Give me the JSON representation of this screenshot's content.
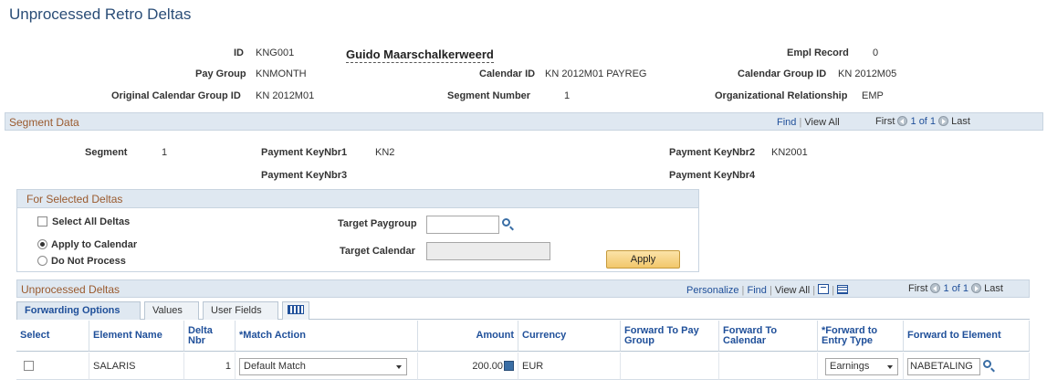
{
  "page": {
    "title": "Unprocessed Retro Deltas"
  },
  "header": {
    "id_label": "ID",
    "id_value": "KNG001",
    "name": "Guido Maarschalkerweerd",
    "empl_record_label": "Empl Record",
    "empl_record_value": "0",
    "pay_group_label": "Pay Group",
    "pay_group_value": "KNMONTH",
    "calendar_id_label": "Calendar ID",
    "calendar_id_value": "KN 2012M01 PAYREG",
    "calendar_group_id_label": "Calendar Group ID",
    "calendar_group_id_value": "KN 2012M05",
    "orig_cal_group_label": "Original Calendar Group ID",
    "orig_cal_group_value": "KN 2012M01",
    "segment_number_label": "Segment Number",
    "segment_number_value": "1",
    "org_rel_label": "Organizational Relationship",
    "org_rel_value": "EMP"
  },
  "segment_data": {
    "title": "Segment Data",
    "find": "Find",
    "view_all": "View All",
    "first": "First",
    "count": "1 of 1",
    "last": "Last",
    "segment_label": "Segment",
    "segment_value": "1",
    "pk1_label": "Payment KeyNbr1",
    "pk1_value": "KN2",
    "pk2_label": "Payment KeyNbr2",
    "pk2_value": "KN2001",
    "pk3_label": "Payment KeyNbr3",
    "pk3_value": "",
    "pk4_label": "Payment KeyNbr4",
    "pk4_value": ""
  },
  "selected_deltas": {
    "title": "For Selected Deltas",
    "select_all": "Select All Deltas",
    "apply_calendar": "Apply to Calendar",
    "do_not_process": "Do Not Process",
    "target_paygroup_label": "Target Paygroup",
    "target_paygroup_value": "",
    "target_calendar_label": "Target Calendar",
    "target_calendar_value": "",
    "apply_button": "Apply"
  },
  "unprocessed": {
    "title": "Unprocessed Deltas",
    "personalize": "Personalize",
    "find": "Find",
    "view_all": "View All",
    "first": "First",
    "count": "1 of 1",
    "last": "Last",
    "tabs": [
      "Forwarding Options",
      "Values",
      "User Fields"
    ],
    "columns": {
      "select": "Select",
      "element_name": "Element Name",
      "delta_nbr": "Delta Nbr",
      "match_action": "*Match Action",
      "amount": "Amount",
      "currency": "Currency",
      "fwd_pay_group": "Forward To Pay Group",
      "fwd_calendar": "Forward To Calendar",
      "fwd_entry_type": "*Forward to Entry Type",
      "fwd_element": "Forward to Element"
    },
    "row": {
      "element_name": "SALARIS",
      "delta_nbr": "1",
      "match_action": "Default Match",
      "amount": "200.00",
      "currency": "EUR",
      "fwd_pay_group": "",
      "fwd_calendar": "",
      "entry_type": "Earnings",
      "fwd_element": "NABETALING"
    }
  }
}
